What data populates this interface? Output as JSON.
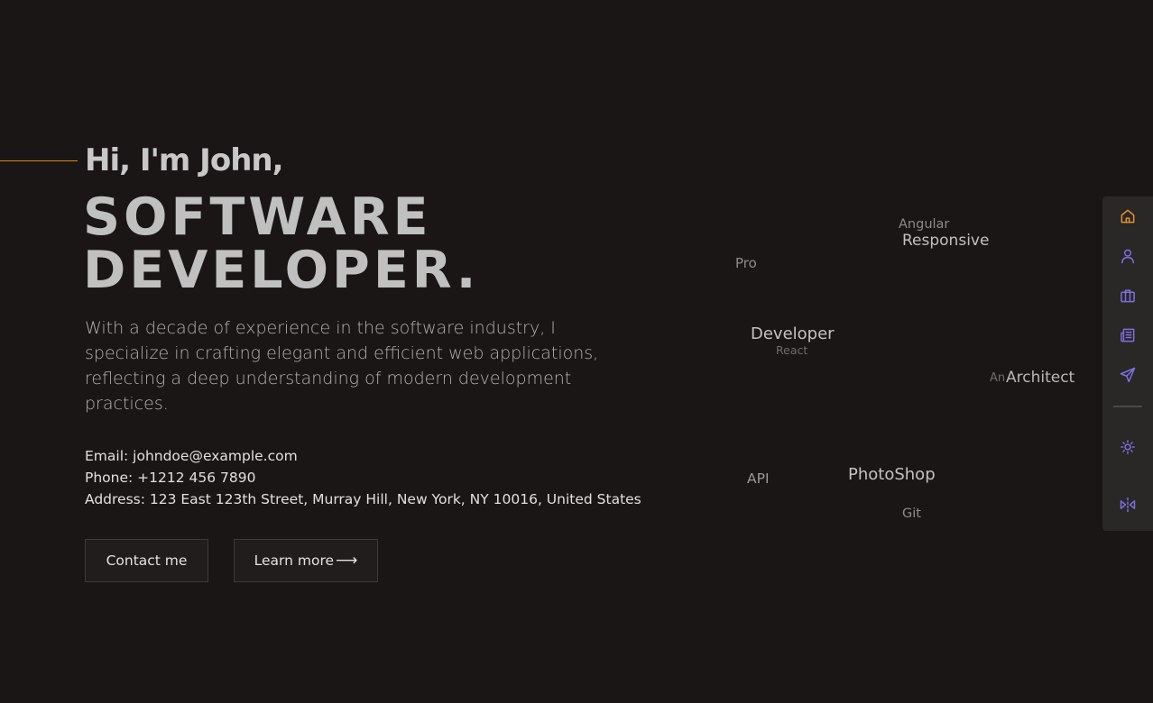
{
  "hero": {
    "greeting": "Hi, I'm John,",
    "headline_line1": "SOFTWARE",
    "headline_line2": "DEVELOPER.",
    "intro": "With a decade of experience in the software industry, I specialize in crafting elegant and efficient web applications, reflecting a deep understanding of modern development practices."
  },
  "contact": {
    "email": "Email: johndoe@example.com",
    "phone": "Phone: +1212 456 7890",
    "address": "Address: 123 East 123th Street, Murray Hill, New York, NY 10016, United States"
  },
  "buttons": {
    "contact_label": "Contact me",
    "learn_label": "Learn more",
    "learn_arrow": "⟶"
  },
  "word_cloud": [
    "Angular",
    "Responsive",
    "Pro",
    "Developer",
    "React",
    "An",
    "Architect",
    "API",
    "PhotoShop",
    "Git"
  ],
  "sidebar": {
    "items": [
      {
        "icon": "home-icon",
        "active": true
      },
      {
        "icon": "user-icon",
        "active": false
      },
      {
        "icon": "briefcase-icon",
        "active": false
      },
      {
        "icon": "newspaper-icon",
        "active": false
      },
      {
        "icon": "send-icon",
        "active": false
      },
      {
        "icon": "sun-icon",
        "active": false
      },
      {
        "icon": "split-icon",
        "active": false
      }
    ]
  },
  "colors": {
    "background": "#1a1616",
    "accent": "#d9891f",
    "icon": "#7b6fe0",
    "sidebar_bg": "#2a2727"
  }
}
